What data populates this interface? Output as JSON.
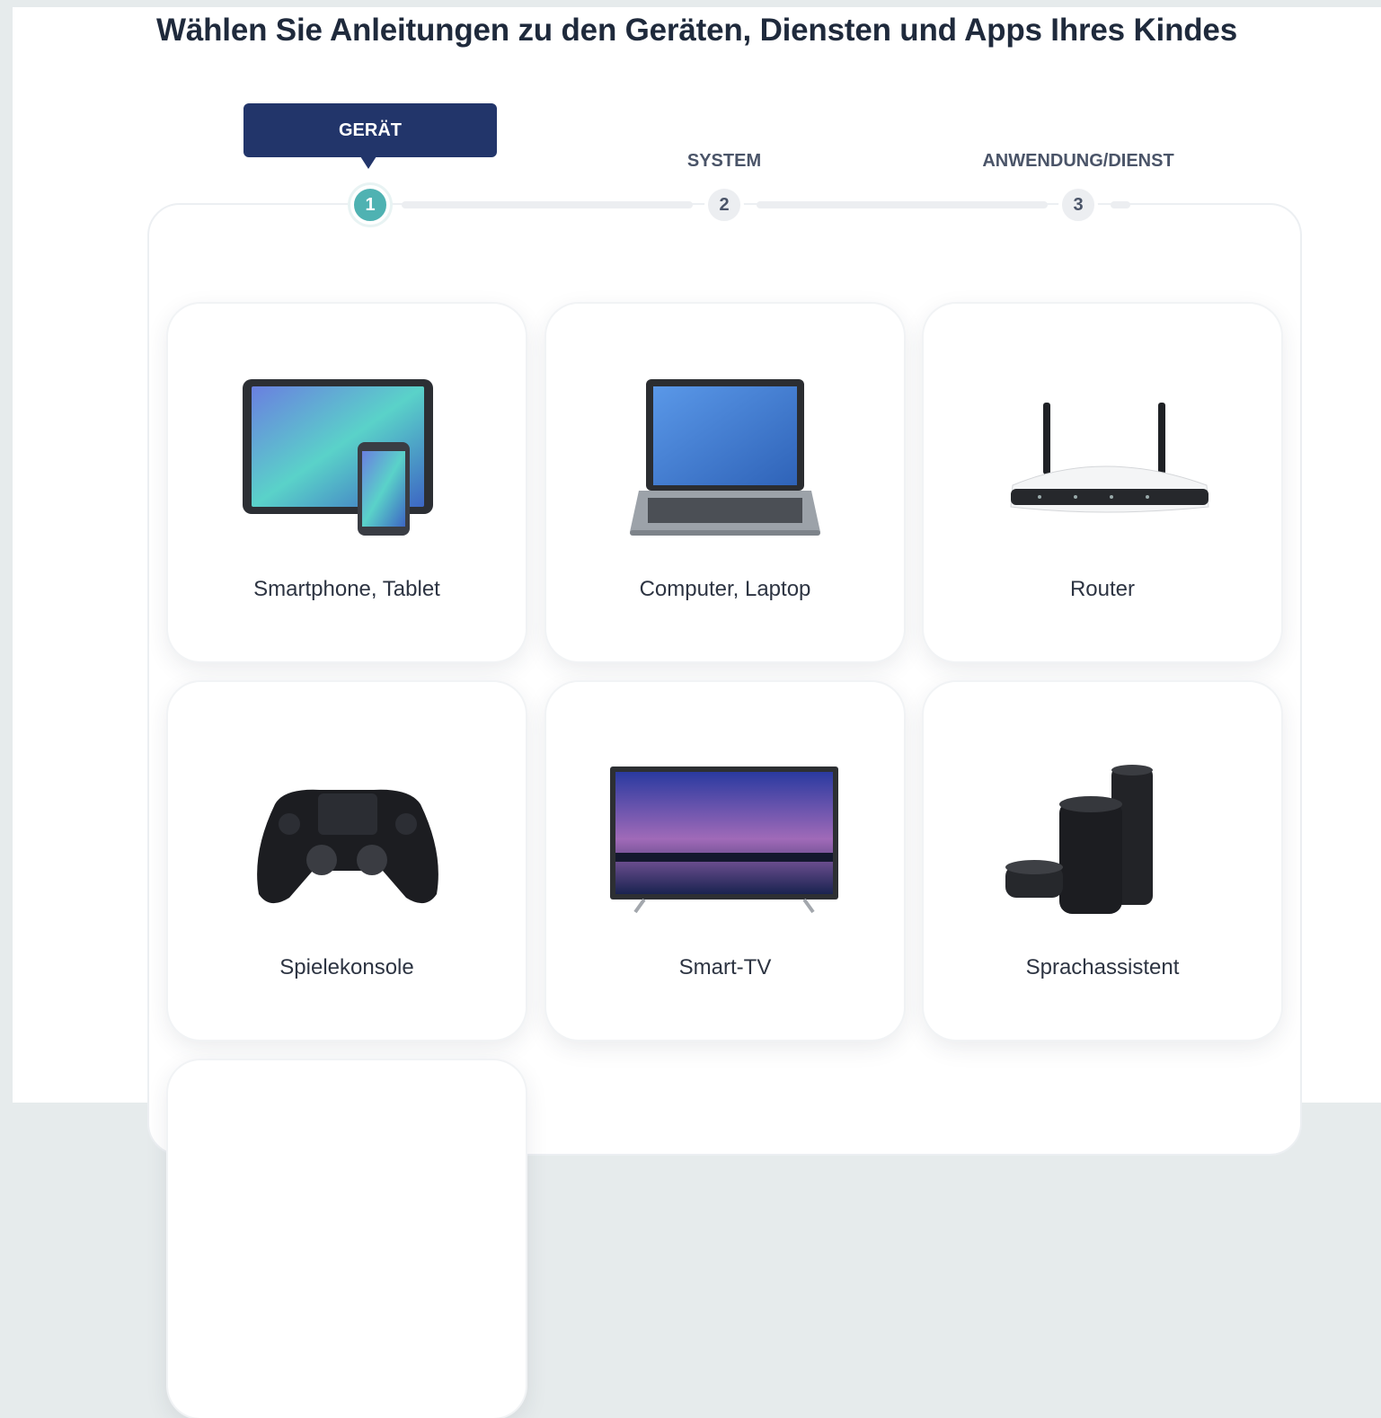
{
  "page": {
    "title": "Wählen Sie Anleitungen zu den Geräten, Diensten und Apps Ihres Kindes"
  },
  "stepper": {
    "tooltip": "GERÄT",
    "steps": [
      {
        "number": "1",
        "label": "GERÄT",
        "active": true
      },
      {
        "number": "2",
        "label": "SYSTEM",
        "active": false
      },
      {
        "number": "3",
        "label": "ANWENDUNG/DIENST",
        "active": false
      }
    ]
  },
  "devices": [
    {
      "label": "Smartphone, Tablet",
      "icon": "tablet-smartphone-icon"
    },
    {
      "label": "Computer, Laptop",
      "icon": "laptop-icon"
    },
    {
      "label": "Router",
      "icon": "router-icon"
    },
    {
      "label": "Spielekonsole",
      "icon": "gamepad-icon"
    },
    {
      "label": "Smart-TV",
      "icon": "tv-icon"
    },
    {
      "label": "Sprachassistent",
      "icon": "smart-speaker-icon"
    }
  ],
  "colors": {
    "accent": "#4fb2b2",
    "tooltip": "#22356a",
    "title": "#1f2a3c"
  }
}
